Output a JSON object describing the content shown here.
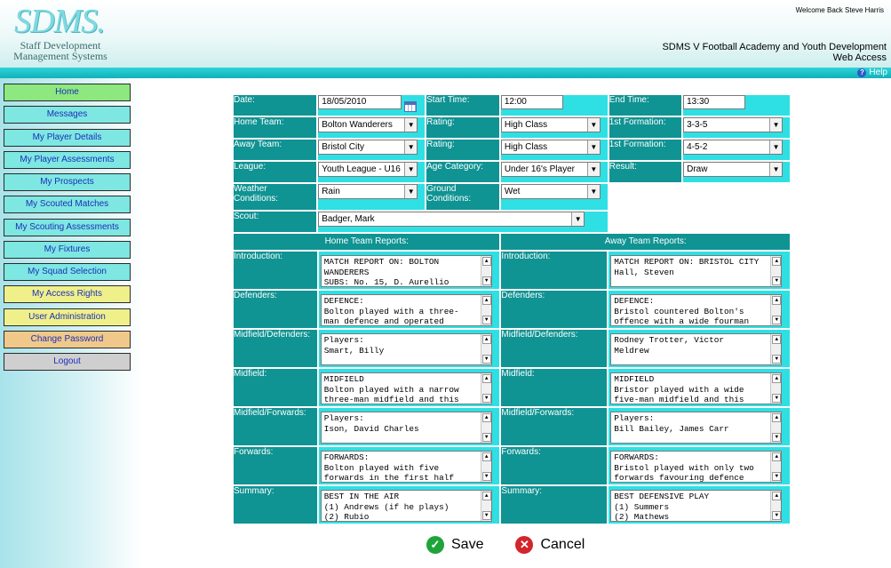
{
  "header": {
    "logo_text": "SDMS.",
    "logo_sub_1": "Staff Development",
    "logo_sub_2": "Management Systems",
    "welcome": "Welcome Back Steve Harris",
    "title_1": "SDMS V Football Academy and Youth Development",
    "title_2": "Web Access",
    "help_label": "Help"
  },
  "nav": {
    "items": [
      {
        "label": "Home",
        "color": "#8de87f"
      },
      {
        "label": "Messages",
        "color": "#7ee7e2"
      },
      {
        "label": "My Player Details",
        "color": "#7ee7e2"
      },
      {
        "label": "My Player Assessments",
        "color": "#7ee7e2"
      },
      {
        "label": "My Prospects",
        "color": "#7ee7e2"
      },
      {
        "label": "My Scouted Matches",
        "color": "#7ee7e2"
      },
      {
        "label": "My Scouting Assessments",
        "color": "#7ee7e2"
      },
      {
        "label": "My Fixtures",
        "color": "#7ee7e2"
      },
      {
        "label": "My Squad Selection",
        "color": "#7ee7e2"
      },
      {
        "label": "My Access Rights",
        "color": "#f0f08a"
      },
      {
        "label": "User Administration",
        "color": "#f0f08a"
      },
      {
        "label": "Change Password",
        "color": "#f0c98a"
      },
      {
        "label": "Logout",
        "color": "#cfcfcf"
      }
    ]
  },
  "form": {
    "date_label": "Date:",
    "date_value": "18/05/2010",
    "start_label": "Start Time:",
    "start_value": "12:00",
    "end_label": "End Time:",
    "end_value": "13:30",
    "home_team_label": "Home Team:",
    "home_team_value": "Bolton Wanderers",
    "away_team_label": "Away Team:",
    "away_team_value": "Bristol City",
    "rating_label": "Rating:",
    "home_rating_value": "High Class",
    "away_rating_value": "High Class",
    "formation_label": "1st Formation:",
    "home_formation_value": "3-3-5",
    "away_formation_value": "4-5-2",
    "league_label": "League:",
    "league_value": "Youth League - U16",
    "age_label": "Age Category:",
    "age_value": "Under 16's Player",
    "result_label": "Result:",
    "result_value": "Draw",
    "weather_label_1": "Weather",
    "weather_label_2": "Conditions:",
    "weather_value": "Rain",
    "ground_label_1": "Ground",
    "ground_label_2": "Conditions:",
    "ground_value": "Wet",
    "scout_label": "Scout:",
    "scout_value": "Badger, Mark",
    "home_reports_header": "Home Team Reports:",
    "away_reports_header": "Away Team Reports:"
  },
  "reports": [
    {
      "label": "Introduction:",
      "home": "MATCH REPORT ON: BOLTON\nWANDERERS\nSUBS: No. 15, D. Aurellio",
      "away": "MATCH REPORT ON: BRISTOL CITY\nHall, Steven"
    },
    {
      "label": "Defenders:",
      "home": "DEFENCE:\nBolton played with a three-\nman defence and operated",
      "away": "DEFENCE:\nBristol countered Bolton's\noffence with a wide fourman"
    },
    {
      "label": "Midfield/Defenders:",
      "home": "Players:\nSmart, Billy",
      "away": "Rodney Trotter, Victor\nMeldrew"
    },
    {
      "label": "Midfield:",
      "home": "MIDFIELD\nBolton played with a narrow\nthree-man midfield and this",
      "away": "MIDFIELD\nBristor played with a wide\nfive-man midfield and this"
    },
    {
      "label": "Midfield/Forwards:",
      "home": "Players:\nIson, David Charles",
      "away": "Players:\nBill Bailey, James Carr"
    },
    {
      "label": "Forwards:",
      "home": "FORWARDS:\nBolton played with five\nforwards in the first half",
      "away": "FORWARDS:\nBristol played with only two\nforwards favouring defence"
    },
    {
      "label": "Summary:",
      "home": "BEST IN THE AIR\n(1) Andrews (if he plays)\n(2) Rubio",
      "away": "BEST DEFENSIVE PLAY\n(1) Summers\n(2) Mathews"
    }
  ],
  "actions": {
    "save_label": "Save",
    "cancel_label": "Cancel"
  }
}
